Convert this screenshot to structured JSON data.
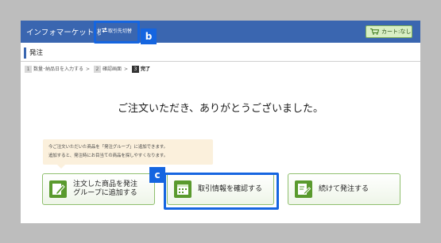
{
  "header": {
    "app_title": "インフォマーケット(株)",
    "partner_switch_label": "取引先切替",
    "cart_label": "カート:なし",
    "brand_color": "#3a66b0"
  },
  "page": {
    "heading": "発注"
  },
  "steps": [
    {
      "number": "1",
      "label": "数量･納品日を入力する"
    },
    {
      "number": "2",
      "label": "確認画面"
    },
    {
      "number": "3",
      "label": "完了"
    }
  ],
  "step_arrow": ">",
  "main": {
    "thanks_message": "ご注文いただき、ありがとうございました。",
    "tooltip_line1": "今ご注文いただいた商品を「発注グループ」に追加できます。",
    "tooltip_line2": "追加すると、発注時にお目当ての商品を探しやすくなります。"
  },
  "buttons": {
    "add_to_group_line1": "注文した商品を発注",
    "add_to_group_line2": "グループに追加する",
    "confirm_transaction": "取引情報を確認する",
    "continue_order": "続けて発注する"
  },
  "annotations": {
    "badge_b": "b",
    "badge_c": "c",
    "highlight_color": "#1565e0"
  },
  "icons": [
    "swap-icon",
    "cart-icon",
    "edit-icon",
    "calendar-icon",
    "document-edit-icon"
  ]
}
